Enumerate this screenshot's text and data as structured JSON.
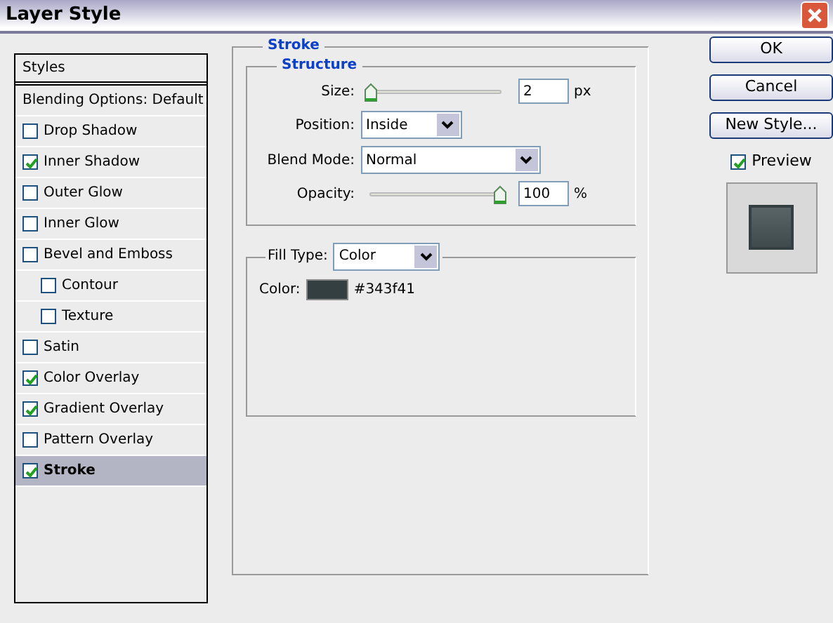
{
  "window": {
    "title": "Layer Style"
  },
  "sidebar": {
    "header": "Styles",
    "blending": "Blending Options: Default",
    "items": [
      {
        "label": "Drop Shadow",
        "checked": false,
        "selected": false
      },
      {
        "label": "Inner Shadow",
        "checked": true,
        "selected": false
      },
      {
        "label": "Outer Glow",
        "checked": false,
        "selected": false
      },
      {
        "label": "Inner Glow",
        "checked": false,
        "selected": false
      },
      {
        "label": "Bevel and Emboss",
        "checked": false,
        "selected": false,
        "children": [
          {
            "label": "Contour",
            "checked": false,
            "selected": false
          },
          {
            "label": "Texture",
            "checked": false,
            "selected": false
          }
        ]
      },
      {
        "label": "Satin",
        "checked": false,
        "selected": false
      },
      {
        "label": "Color Overlay",
        "checked": true,
        "selected": false
      },
      {
        "label": "Gradient Overlay",
        "checked": true,
        "selected": false
      },
      {
        "label": "Pattern Overlay",
        "checked": false,
        "selected": false
      },
      {
        "label": "Stroke",
        "checked": true,
        "selected": true
      }
    ]
  },
  "stroke": {
    "title": "Stroke",
    "structure": {
      "title": "Structure",
      "size": {
        "label": "Size:",
        "level": 0.0,
        "value": "2",
        "unit": "px"
      },
      "position": {
        "label": "Position:",
        "value": "Inside"
      },
      "blend_mode": {
        "label": "Blend Mode:",
        "value": "Normal"
      },
      "opacity": {
        "label": "Opacity:",
        "level": 1.0,
        "value": "100",
        "unit": "%"
      }
    },
    "fill_type": {
      "label": "Fill Type:",
      "value": "Color"
    },
    "color": {
      "label": "Color:",
      "color": "#343f41",
      "value": "#343f41"
    }
  },
  "buttons": [
    "OK",
    "Cancel",
    "New Style..."
  ],
  "preview": {
    "label": "Preview",
    "checked": true
  }
}
